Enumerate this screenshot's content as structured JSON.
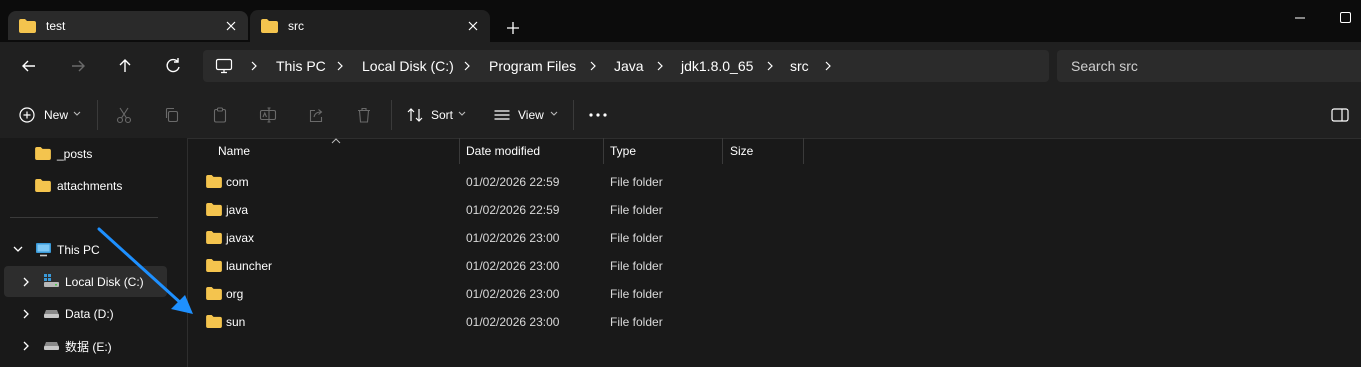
{
  "window": {
    "tabs": [
      {
        "label": "test",
        "active": false
      },
      {
        "label": "src",
        "active": true
      }
    ]
  },
  "breadcrumb": [
    "This PC",
    "Local Disk (C:)",
    "Program Files",
    "Java",
    "jdk1.8.0_65",
    "src"
  ],
  "search": {
    "placeholder": "Search src"
  },
  "toolbar": {
    "new_label": "New",
    "sort_label": "Sort",
    "view_label": "View"
  },
  "sidebar": {
    "quick_items": [
      "_posts",
      "attachments"
    ],
    "this_pc_label": "This PC",
    "drives": [
      "Local Disk (C:)",
      "Data (D:)",
      "数据 (E:)"
    ]
  },
  "columns": {
    "name": "Name",
    "date": "Date modified",
    "type": "Type",
    "size": "Size"
  },
  "files": [
    {
      "name": "com",
      "date": "01/02/2026 22:59",
      "type": "File folder"
    },
    {
      "name": "java",
      "date": "01/02/2026 22:59",
      "type": "File folder"
    },
    {
      "name": "javax",
      "date": "01/02/2026 23:00",
      "type": "File folder"
    },
    {
      "name": "launcher",
      "date": "01/02/2026 23:00",
      "type": "File folder"
    },
    {
      "name": "org",
      "date": "01/02/2026 23:00",
      "type": "File folder"
    },
    {
      "name": "sun",
      "date": "01/02/2026 23:00",
      "type": "File folder"
    }
  ],
  "colors": {
    "folder": "#f4c44e",
    "annotation_arrow": "#1e90ff",
    "selected_bg": "#2d2d2d"
  }
}
